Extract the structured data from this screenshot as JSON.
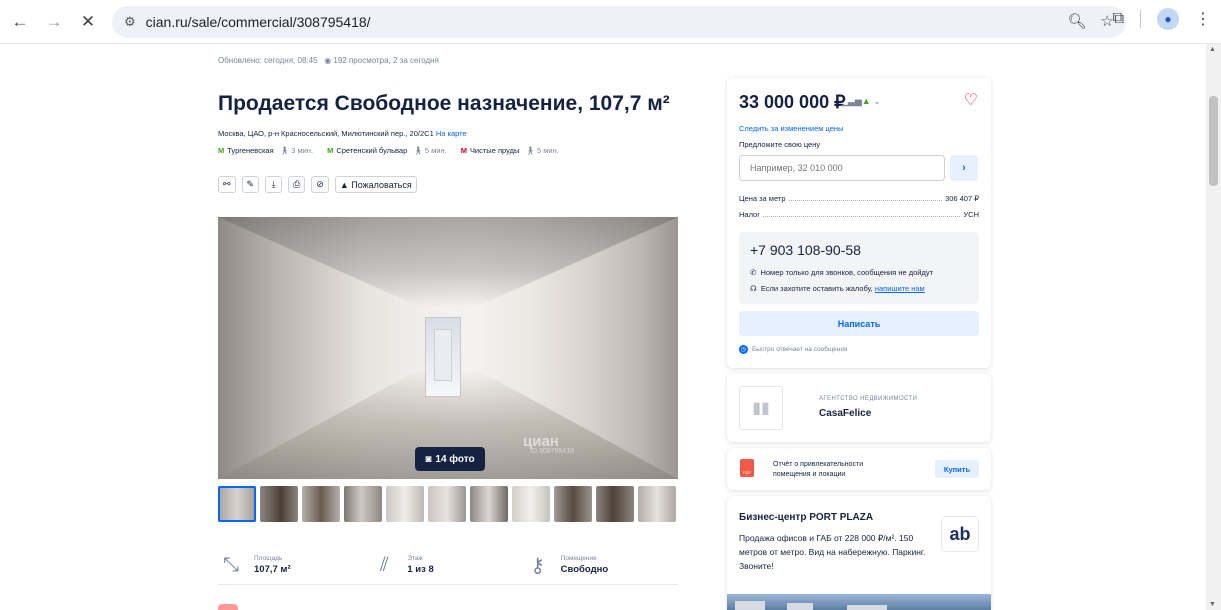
{
  "browser": {
    "url": "cian.ru/sale/commercial/308795418/",
    "back_icon": "arrow-left-icon",
    "forward_icon": "arrow-right-icon",
    "stop_icon": "close-icon"
  },
  "listing": {
    "updated": "Обновлено: сегодня, 08:45",
    "views": "192 просмотра, 2 за сегодня",
    "title": "Продается Свободное назначение, 107,7 м²",
    "address": "Москва, ЦАО, р-н Красносельский, Милютинский пер., 20/2С1",
    "map_link": "На карте",
    "metro": [
      {
        "name": "Тургеневская",
        "walk": "3 мин.",
        "color": "#41a317"
      },
      {
        "name": "Сретенский бульвар",
        "walk": "5 мин.",
        "color": "#41a317"
      },
      {
        "name": "Чистые пруды",
        "walk": "5 мин.",
        "color": "#d0021b"
      }
    ],
    "complain_label": "Пожаловаться",
    "photo_count": "14 фото",
    "watermark": "циан",
    "watermark_id": "ID 308795418",
    "features": [
      {
        "label": "Площадь",
        "value": "107,7 м²",
        "icon": "area-icon"
      },
      {
        "label": "Этаж",
        "value": "1 из 8",
        "icon": "stairs-icon"
      },
      {
        "label": "Помещение",
        "value": "Свободно",
        "icon": "key-icon"
      }
    ]
  },
  "price_card": {
    "price": "33 000 000 ₽",
    "follow_price": "Следить за изменением цены",
    "offer_label": "Предложите свою цену",
    "offer_placeholder": "Например, 32 010 000",
    "price_per_m_label": "Цена за метр",
    "price_per_m_value": "306 407 ₽",
    "tax_label": "Налог",
    "tax_value": "УСН",
    "phone": "+7 903 108-90-58",
    "phone_note": "Номер только для звонков, сообщения не дойдут",
    "complaint_note": "Если захотите оставить жалобу,",
    "complaint_link": "напишите нам",
    "write_button": "Написать",
    "fast_reply": "Быстро отвечает на сообщения"
  },
  "agency": {
    "tag": "АГЕНТСТВО НЕДВИЖИМОСТИ",
    "name": "CasaFelice"
  },
  "report": {
    "line1": "Отчёт о привлекательности",
    "line2": "помещения и локации",
    "buy_button": "Купить",
    "pdf_label": "PDF"
  },
  "ad": {
    "title": "Бизнес-центр PORT PLAZA",
    "text": "Продажа офисов и ГАБ от 228 000 ₽/м². 150 метров от метро. Вид на набережную. Паркинг. Звоните!",
    "logo_text": "ab"
  }
}
